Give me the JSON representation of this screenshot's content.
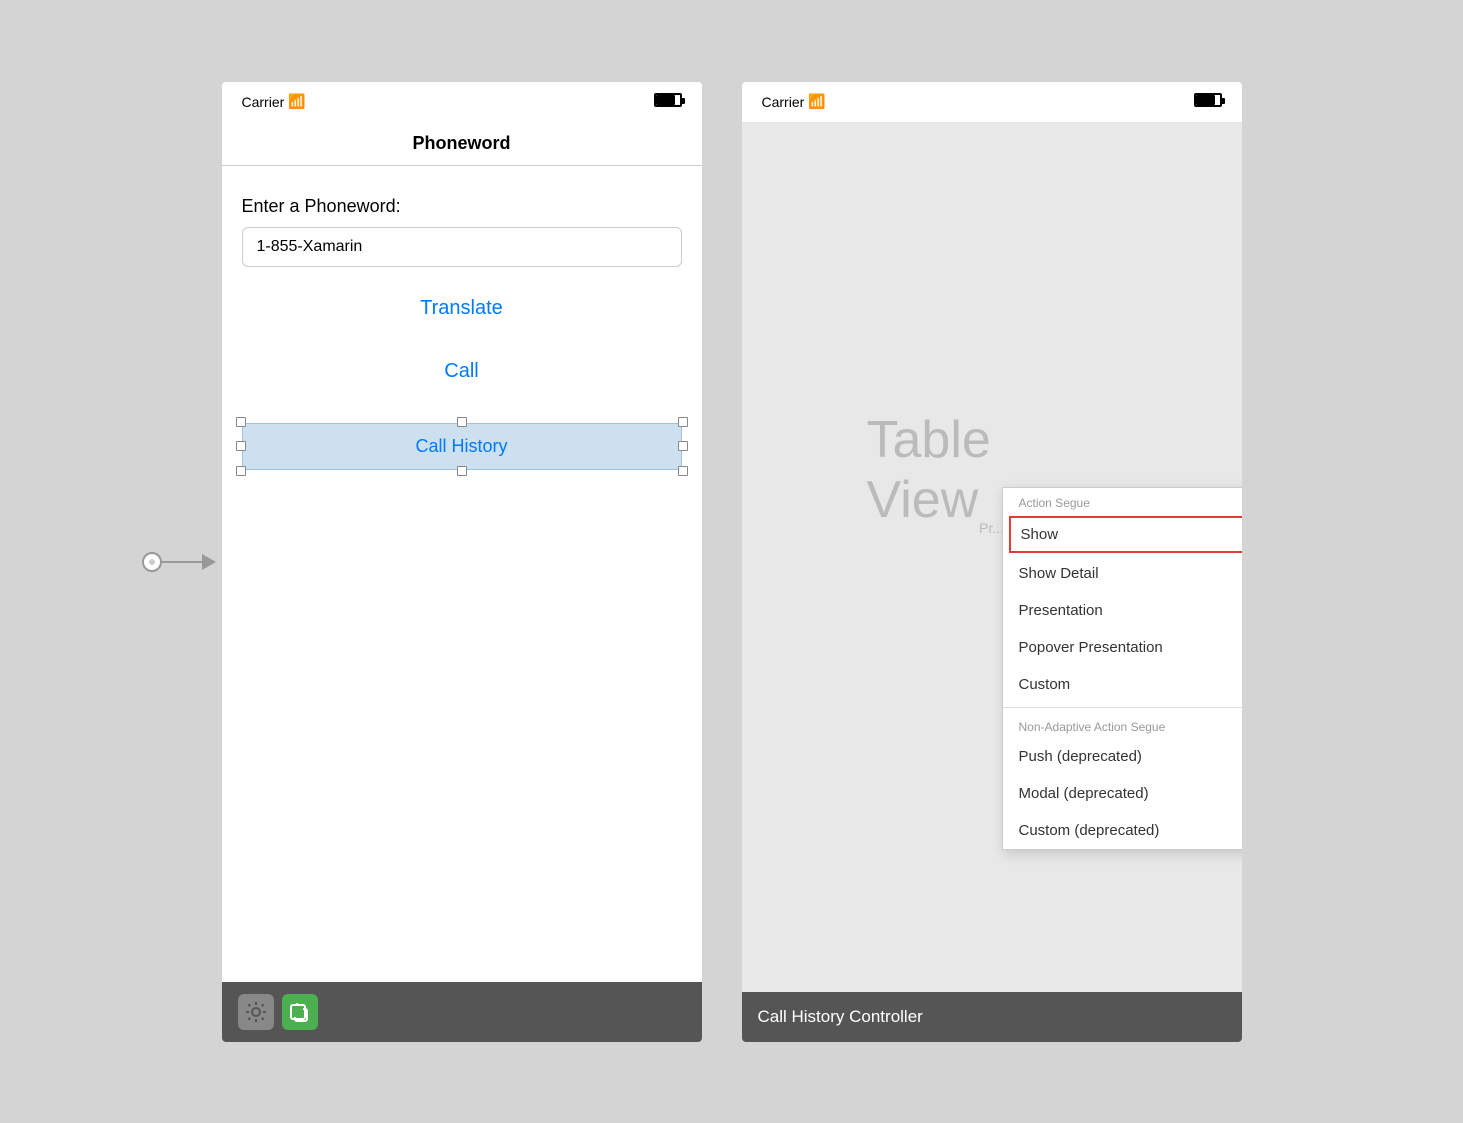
{
  "left_phone": {
    "statusbar": {
      "carrier": "Carrier",
      "wifi": "📶",
      "battery": "🔋"
    },
    "navbar": {
      "title": "Phoneword"
    },
    "content": {
      "label": "Enter a Phoneword:",
      "input_value": "1-855-Xamarin",
      "input_placeholder": "1-855-Xamarin",
      "translate_button": "Translate",
      "call_button": "Call",
      "call_history_button": "Call History"
    },
    "toolbar": {
      "icon1": "⚙",
      "icon2": "↪"
    }
  },
  "right_panel": {
    "statusbar": {
      "carrier": "Carrier"
    },
    "content": {
      "table_view_label": "Table View",
      "prototype_label": "Pr..."
    },
    "dropdown": {
      "action_segue_header": "Action Segue",
      "items": [
        {
          "label": "Show",
          "selected": true
        },
        {
          "label": "Show Detail",
          "selected": false
        },
        {
          "label": "Presentation",
          "selected": false
        },
        {
          "label": "Popover Presentation",
          "selected": false
        },
        {
          "label": "Custom",
          "selected": false
        }
      ],
      "non_adaptive_header": "Non-Adaptive Action Segue",
      "non_adaptive_items": [
        {
          "label": "Push (deprecated)"
        },
        {
          "label": "Modal (deprecated)"
        },
        {
          "label": "Custom (deprecated)"
        }
      ]
    },
    "footer": {
      "title": "Call History Controller"
    }
  }
}
